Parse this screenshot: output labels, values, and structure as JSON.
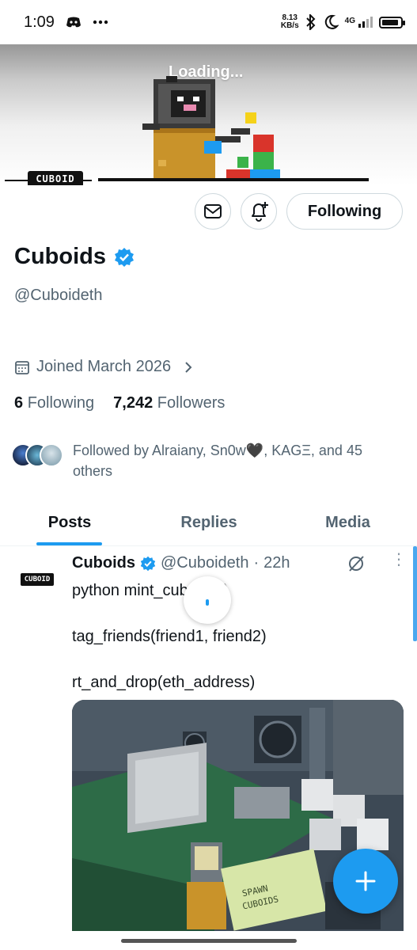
{
  "status_bar": {
    "time": "1:09",
    "net_speed_value": "8.13",
    "net_speed_unit": "KB/s",
    "network": "4G"
  },
  "banner": {
    "loading_text": "Loading...",
    "logo_text": "CUBOID"
  },
  "actions": {
    "message_icon": "envelope-icon",
    "notify_icon": "bell-plus-icon",
    "follow_label": "Following"
  },
  "profile": {
    "name": "Cuboids",
    "handle": "@Cuboideth",
    "joined": "Joined March 2026",
    "following_count": "6",
    "following_label": "Following",
    "followers_count": "7,242",
    "followers_label": "Followers",
    "followed_by": "Followed by Alraiany, Sn0w🖤, KAGΞ, and 45 others"
  },
  "tabs": [
    {
      "label": "Posts",
      "active": true
    },
    {
      "label": "Replies",
      "active": false
    },
    {
      "label": "Media",
      "active": false
    }
  ],
  "post": {
    "avatar_text": "CUBOID",
    "author": "Cuboids",
    "handle": "@Cuboideth",
    "time": "22h",
    "separator": "·",
    "text": "python mint_cuboid(1)\n\ntag_friends(friend1, friend2)\n\nrt_and_drop(eth_address)",
    "media": {
      "label_spawn": "SPAWN",
      "label_cuboids": "CUBOIDS"
    }
  },
  "colors": {
    "accent": "#1d9bf0",
    "muted_text": "#536471",
    "primary_text": "#0f1419",
    "border": "#cfd9de"
  },
  "fab": {
    "icon": "plus-icon"
  }
}
